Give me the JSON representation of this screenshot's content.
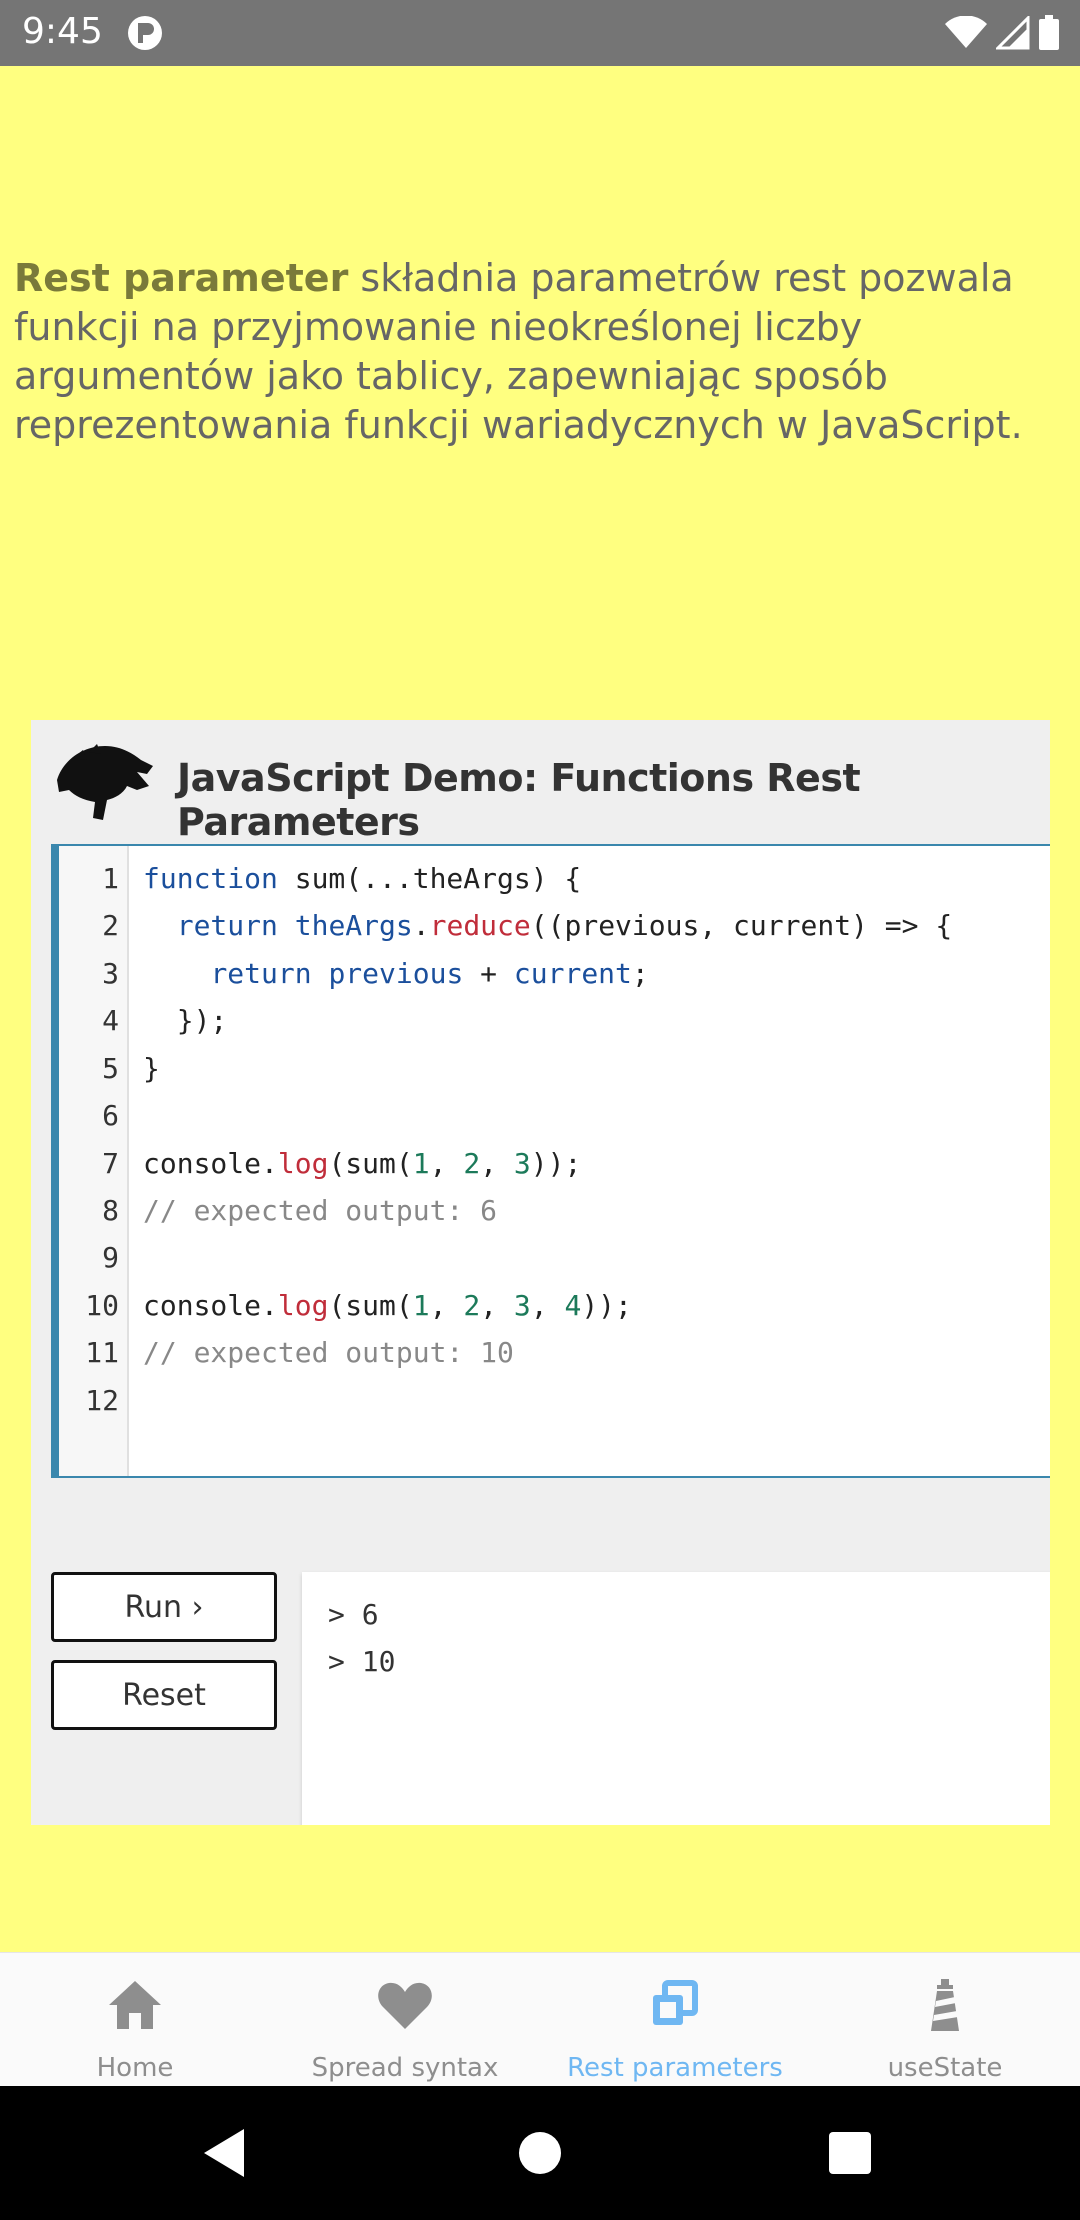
{
  "status_bar": {
    "time": "9:45"
  },
  "description": {
    "bold": "Rest parameter",
    "text": "  składnia parametrów rest pozwala funkcji na przyjmowanie nieokreślonej liczby argumentów jako tablicy, zapewniając sposób reprezentowania funkcji wariadycznych w JavaScript."
  },
  "demo": {
    "title": "JavaScript Demo: Functions Rest Parameters",
    "line_numbers": [
      "1",
      "2",
      "3",
      "4",
      "5",
      "6",
      "7",
      "8",
      "9",
      "10",
      "11",
      "12"
    ],
    "code": {
      "l1": [
        "function",
        " sum(...theArgs) {"
      ],
      "l2": [
        "  ",
        "return",
        " ",
        "theArgs",
        ".",
        "reduce",
        "((previous, current) => {"
      ],
      "l3": [
        "    ",
        "return",
        " ",
        "previous",
        " + ",
        "current",
        ";"
      ],
      "l4": "  });",
      "l5": "}",
      "l7": [
        "console.",
        "log",
        "(sum(",
        "1",
        ", ",
        "2",
        ", ",
        "3",
        "));"
      ],
      "l8": "// expected output: 6",
      "l10": [
        "console.",
        "log",
        "(sum(",
        "1",
        ", ",
        "2",
        ", ",
        "3",
        ", ",
        "4",
        "));"
      ],
      "l11": "// expected output: 10"
    },
    "run_label": "Run ›",
    "reset_label": "Reset",
    "console_output": [
      "> 6",
      "> 10"
    ]
  },
  "bottom_nav": {
    "items": [
      {
        "label": "Home",
        "icon": "home-icon",
        "active": false
      },
      {
        "label": "Spread syntax",
        "icon": "heart-icon",
        "active": false
      },
      {
        "label": "Rest parameters",
        "icon": "stacked-squares-icon",
        "active": true
      },
      {
        "label": "useState",
        "icon": "lighthouse-icon",
        "active": false
      }
    ]
  },
  "colors": {
    "background": "#ffff80",
    "active_tab": "#6fb7f2",
    "inactive_tab": "#8e8e8e",
    "editor_border": "#3a87ad"
  }
}
